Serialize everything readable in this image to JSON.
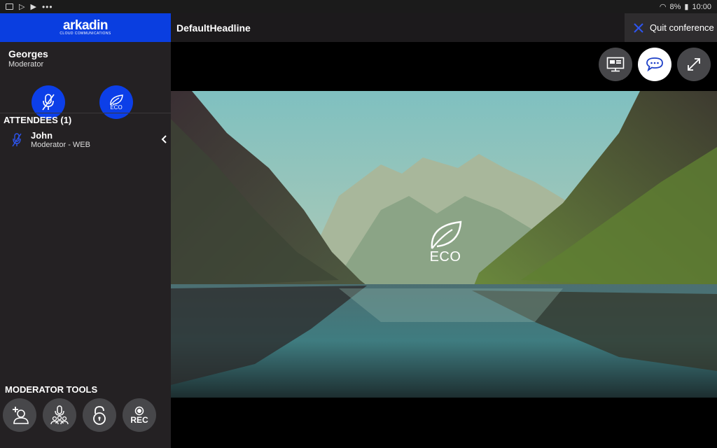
{
  "status_bar": {
    "battery": "8%",
    "time": "10:00"
  },
  "brand": {
    "name": "arkadin",
    "tagline": "CLOUD COMMUNICATIONS"
  },
  "user": {
    "name": "Georges",
    "role": "Moderator"
  },
  "header": {
    "headline": "DefaultHeadline",
    "quit_label": "Quit conference"
  },
  "attendees": {
    "header": "ATTENDEES (1)",
    "items": [
      {
        "name": "John",
        "role": "Moderator - WEB"
      }
    ]
  },
  "moderator_tools": {
    "header": "MODERATOR TOOLS",
    "rec_label": "REC"
  },
  "eco": {
    "label": "ECO",
    "mini_label": "ECO"
  },
  "icons": {
    "mute": "mic-off-icon",
    "eco": "leaf-icon",
    "screen": "screen-share-icon",
    "chat": "chat-icon",
    "fullscreen": "expand-icon",
    "add_user": "add-user-icon",
    "mute_all": "mute-all-icon",
    "lock": "lock-icon",
    "record": "record-icon",
    "close": "close-icon",
    "collapse": "chevron-left-icon"
  },
  "colors": {
    "brand_blue": "#0a3ee0",
    "sidebar": "#242123",
    "button_gray": "#47474a"
  }
}
